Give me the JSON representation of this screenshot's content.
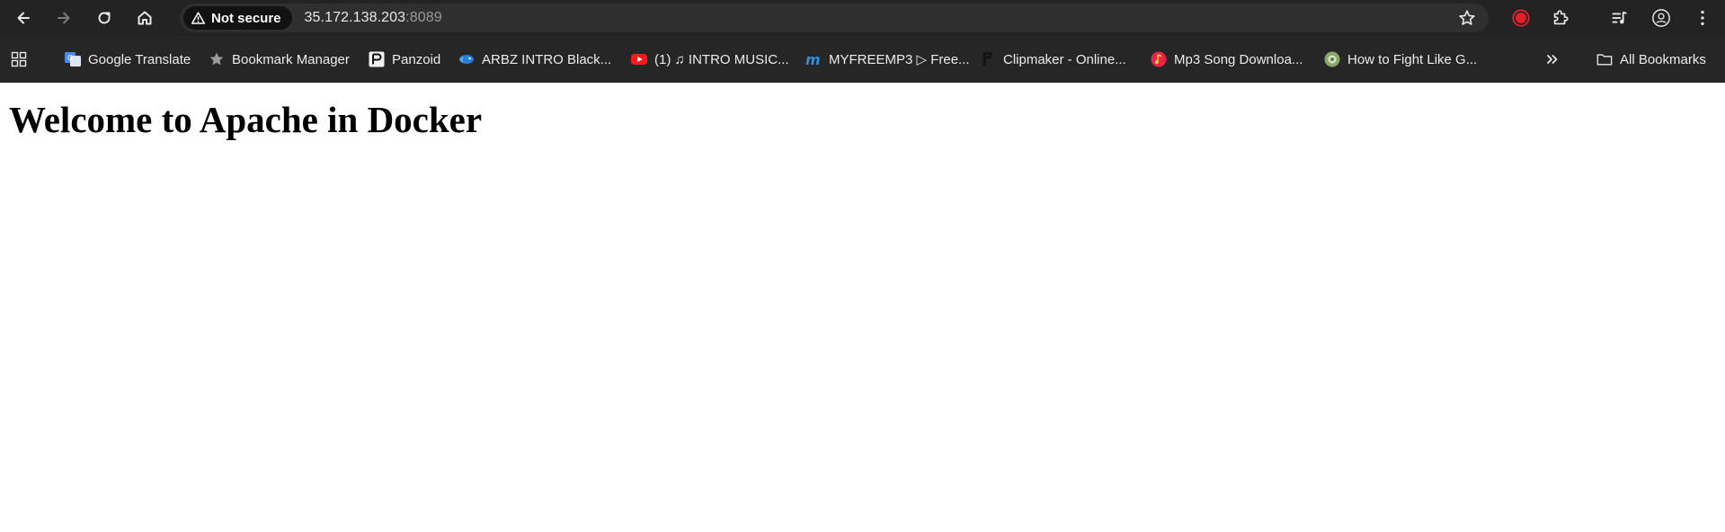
{
  "toolbar": {
    "back_icon": "arrow-left-icon",
    "forward_icon": "arrow-right-icon",
    "reload_icon": "reload-icon",
    "home_icon": "home-icon"
  },
  "omnibox": {
    "security_label": "Not secure",
    "url_host": "35.172.138.203",
    "url_port": ":8089"
  },
  "bookmarks": {
    "items": [
      {
        "label": "Google Translate",
        "icon": "google-translate-icon"
      },
      {
        "label": "Bookmark Manager",
        "icon": "star-icon"
      },
      {
        "label": "Panzoid",
        "icon": "panzoid-icon"
      },
      {
        "label": "ARBZ INTRO Black...",
        "icon": "fish-icon"
      },
      {
        "label": "(1) ♫ INTRO MUSIC...",
        "icon": "youtube-icon"
      },
      {
        "label": "MYFREEMP3 ▷ Free...",
        "icon": "myfreemp3-icon"
      },
      {
        "label": "Clipmaker - Online...",
        "icon": "clipmaker-icon"
      },
      {
        "label": "Mp3 Song Downloa...",
        "icon": "music-icon"
      },
      {
        "label": "How to Fight Like G...",
        "icon": "globe-icon"
      }
    ],
    "overflow_icon": "chevron-double-right-icon",
    "all_bookmarks_label": "All Bookmarks"
  },
  "page": {
    "heading": "Welcome to Apache in Docker"
  },
  "colors": {
    "toolbar_bg": "#232323",
    "omnibox_bg": "#2f2f2f",
    "record_red": "#e0202a"
  }
}
